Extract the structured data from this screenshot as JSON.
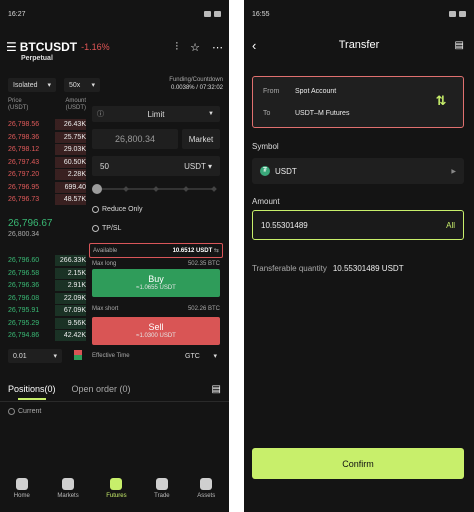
{
  "left": {
    "status": {
      "time": "16:27"
    },
    "header": {
      "pair": "BTCUSDT",
      "change": "-1.16%",
      "subtitle": "Perpetual"
    },
    "margin_mode": "Isolated",
    "leverage": "50x",
    "funding": {
      "label": "Funding/Countdown",
      "value": "0.0038% / 07:32:02"
    },
    "orderbook": {
      "price_header": "Price\n(USDT)",
      "amount_header": "Amount\n(USDT)",
      "asks": [
        {
          "price": "26,798.56",
          "amount": "26.43K"
        },
        {
          "price": "26,798.36",
          "amount": "25.75K"
        },
        {
          "price": "26,798.12",
          "amount": "29.03K"
        },
        {
          "price": "26,797.43",
          "amount": "60.50K"
        },
        {
          "price": "26,797.20",
          "amount": "2.28K"
        },
        {
          "price": "26,796.95",
          "amount": "699.40"
        },
        {
          "price": "26,796.73",
          "amount": "48.57K"
        }
      ],
      "mid_price": "26,796.67",
      "mid_sub": "26,800.34",
      "bids": [
        {
          "price": "26,796.60",
          "amount": "266.33K"
        },
        {
          "price": "26,796.58",
          "amount": "2.15K"
        },
        {
          "price": "26,796.36",
          "amount": "2.91K"
        },
        {
          "price": "26,796.08",
          "amount": "22.09K"
        },
        {
          "price": "26,795.91",
          "amount": "67.09K"
        },
        {
          "price": "26,795.29",
          "amount": "9.56K"
        },
        {
          "price": "26,794.86",
          "amount": "42.42K"
        }
      ]
    },
    "order": {
      "type": "Limit",
      "price": "26,800.34",
      "market_label": "Market",
      "quantity": "50",
      "quantity_unit": "USDT",
      "reduce_only": "Reduce Only",
      "tpsl": "TP/SL",
      "available_label": "Available",
      "available_value": "10.6512 USDT",
      "max_long_label": "Max long",
      "max_long_value": "502.35 BTC",
      "buy_label": "Buy",
      "buy_sub": "≈1.0655 USDT",
      "max_short_label": "Max short",
      "max_short_value": "502.26 BTC",
      "sell_label": "Sell",
      "sell_sub": "≈1.0300 USDT",
      "effective_time_label": "Effective Time",
      "effective_time_value": "GTC"
    },
    "precision": "0.01",
    "tabs": {
      "positions": "Positions(0)",
      "open_orders": "Open order (0)"
    },
    "current_label": "Current",
    "nav": [
      "Home",
      "Markets",
      "Futures",
      "Trade",
      "Assets"
    ]
  },
  "right": {
    "status": {
      "time": "16:55"
    },
    "title": "Transfer",
    "from_label": "From",
    "from_value": "Spot Account",
    "to_label": "To",
    "to_value": "USDT–M Futures",
    "symbol_label": "Symbol",
    "symbol_value": "USDT",
    "amount_label": "Amount",
    "amount_value": "10.55301489",
    "all_label": "All",
    "transferable_label": "Transferable quantity",
    "transferable_value": "10.55301489 USDT",
    "confirm_label": "Confirm"
  },
  "colors": {
    "accent": "#c8ef6b",
    "buy": "#2f9c5a",
    "sell": "#d95555",
    "highlight": "#e0706f"
  }
}
